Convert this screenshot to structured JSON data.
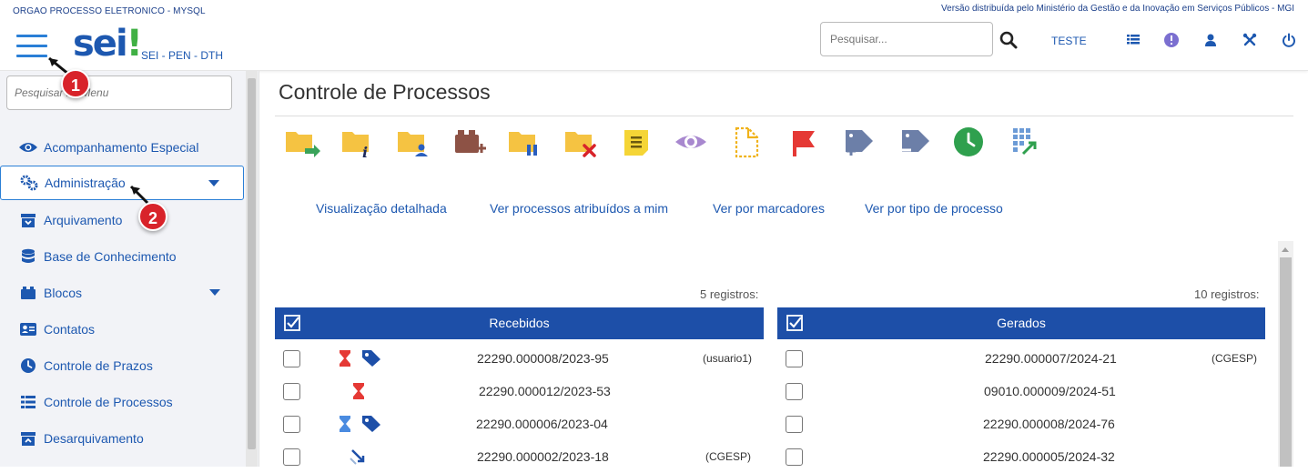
{
  "header": {
    "org_name": "ORGAO PROCESSO ELETRONICO - MYSQL",
    "version_text": "Versão distribuída pelo Ministério da Gestão e da Inovação em Serviços Públicos - MGI",
    "logo_text": "sei",
    "logo_mark": "!",
    "system_name": "SEI - PEN - DTH",
    "search_placeholder": "Pesquisar...",
    "user_label": "TESTE",
    "icons": [
      "list-icon",
      "info-icon",
      "user-icon",
      "tools-icon",
      "power-icon"
    ]
  },
  "annotations": {
    "badge_1": "1",
    "badge_2": "2"
  },
  "sidebar": {
    "search_placeholder": "Pesquisar no Menu",
    "items": [
      {
        "label": "Acompanhamento Especial",
        "icon": "eye-icon"
      },
      {
        "label": "Administração",
        "icon": "gears-icon",
        "expandable": true,
        "active": true
      },
      {
        "label": "Arquivamento",
        "icon": "archive-icon"
      },
      {
        "label": "Base de Conhecimento",
        "icon": "database-icon"
      },
      {
        "label": "Blocos",
        "icon": "blocks-icon",
        "expandable": true
      },
      {
        "label": "Contatos",
        "icon": "contact-card-icon"
      },
      {
        "label": "Controle de Prazos",
        "icon": "clock-icon"
      },
      {
        "label": "Controle de Processos",
        "icon": "list-icon"
      },
      {
        "label": "Desarquivamento",
        "icon": "unarchive-icon"
      }
    ]
  },
  "main": {
    "title": "Controle de Processos",
    "toolbar_icons": [
      "send-process-icon",
      "process-info-icon",
      "assign-process-icon",
      "add-to-block-icon",
      "sobrestar-process-icon",
      "conclude-process-icon",
      "annotation-icon",
      "mark-read-icon",
      "document-dashed-icon",
      "flag-icon",
      "add-marker-icon",
      "remove-marker-icon",
      "deadline-clock-icon",
      "building-link-icon"
    ],
    "view_links": [
      "Visualização detalhada",
      "Ver processos atribuídos a mim",
      "Ver por marcadores",
      "Ver por tipo de processo"
    ],
    "received": {
      "count_text": "5 registros:",
      "title": "Recebidos",
      "rows": [
        {
          "process": "22290.000008/2023-95",
          "assigned": "(usuario1)",
          "icons": [
            "hourglass-red-icon",
            "tag-blue-icon"
          ]
        },
        {
          "process": "22290.000012/2023-53",
          "assigned": "",
          "icons": [
            "hourglass-red-icon"
          ]
        },
        {
          "process": "22290.000006/2023-04",
          "assigned": "",
          "icons": [
            "hourglass-blue-icon",
            "tag-blue-icon"
          ]
        },
        {
          "process": "22290.000002/2023-18",
          "assigned": "(CGESP)",
          "icons": [
            "arrows-diagonal-icon"
          ]
        }
      ]
    },
    "generated": {
      "count_text": "10 registros:",
      "title": "Gerados",
      "rows": [
        {
          "process": "22290.000007/2024-21",
          "assigned": "(CGESP)"
        },
        {
          "process": "09010.000009/2024-51",
          "assigned": ""
        },
        {
          "process": "22290.000008/2024-76",
          "assigned": ""
        },
        {
          "process": "22290.000005/2024-32",
          "assigned": ""
        }
      ]
    }
  },
  "colors": {
    "brand_blue": "#1d58b0",
    "header_blue": "#1d4fa8",
    "badge_red": "#d8232a",
    "folder_yellow": "#f5c342"
  }
}
